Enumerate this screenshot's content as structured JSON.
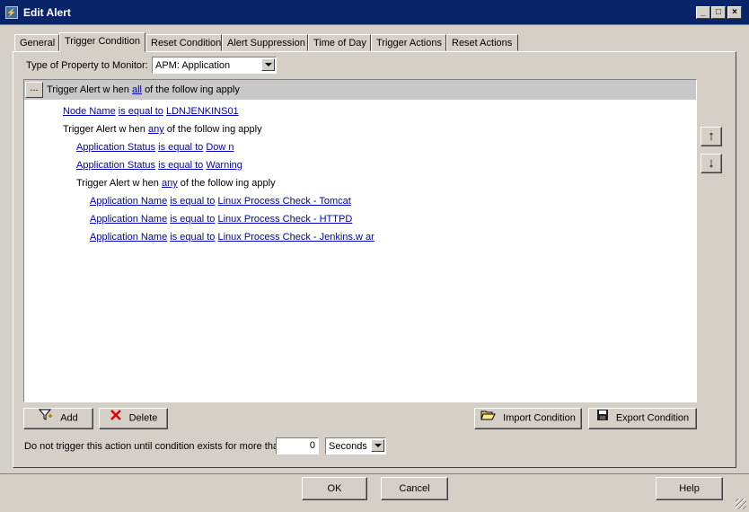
{
  "window": {
    "title": "Edit Alert",
    "minimize": "_",
    "maximize": "□",
    "close": "×"
  },
  "tabs": [
    {
      "label": "General",
      "active": false
    },
    {
      "label": "Trigger Condition",
      "active": true
    },
    {
      "label": "Reset Condition",
      "active": false
    },
    {
      "label": "Alert Suppression",
      "active": false
    },
    {
      "label": "Time of Day",
      "active": false
    },
    {
      "label": "Trigger Actions",
      "active": false
    },
    {
      "label": "Reset Actions",
      "active": false
    }
  ],
  "property": {
    "label": "Type of Property to Monitor:",
    "value": "APM: Application"
  },
  "tree": {
    "dots": "...",
    "root": {
      "prefix": "Trigger Alert w hen",
      "mode": "all",
      "suffix": "of the follow ing apply"
    },
    "node_name": {
      "field": "Node Name",
      "op": "is equal to",
      "value": "LDNJENKINS01"
    },
    "group1": {
      "prefix": "Trigger Alert w hen",
      "mode": "any",
      "suffix": "of the follow ing apply"
    },
    "status1": {
      "field": "Application Status",
      "op": "is equal to",
      "value": "Dow n"
    },
    "status2": {
      "field": "Application Status",
      "op": "is equal to",
      "value": "Warning"
    },
    "group2": {
      "prefix": "Trigger Alert w hen",
      "mode": "any",
      "suffix": "of the follow ing apply"
    },
    "app1": {
      "field": "Application Name",
      "op": "is equal to",
      "value": "Linux Process Check - Tomcat"
    },
    "app2": {
      "field": "Application Name",
      "op": "is equal to",
      "value": "Linux Process Check - HTTPD"
    },
    "app3": {
      "field": "Application Name",
      "op": "is equal to",
      "value": "Linux Process Check - Jenkins.w ar"
    }
  },
  "move_up": "↑",
  "move_down": "↓",
  "buttons": {
    "add": "Add",
    "delete": "Delete",
    "import": "Import Condition",
    "export": "Export Condition",
    "ok": "OK",
    "cancel": "Cancel",
    "help": "Help"
  },
  "delay": {
    "label": "Do not trigger this action until condition exists for more than",
    "value": "0",
    "unit": "Seconds"
  },
  "colors": {
    "title_bar": "#0a246a",
    "link": "#0000c0",
    "face": "#d4d0c8"
  }
}
